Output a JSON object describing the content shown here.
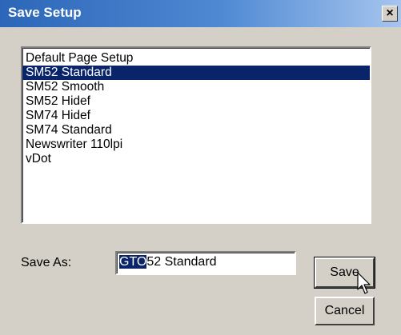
{
  "window": {
    "title": "Save Setup",
    "close_glyph": "×"
  },
  "setup_list": {
    "items": [
      {
        "label": "Default Page Setup",
        "selected": false
      },
      {
        "label": "SM52 Standard",
        "selected": true
      },
      {
        "label": "SM52 Smooth",
        "selected": false
      },
      {
        "label": "SM52 Hidef",
        "selected": false
      },
      {
        "label": "SM74 Hidef",
        "selected": false
      },
      {
        "label": "SM74 Standard",
        "selected": false
      },
      {
        "label": "Newswriter 110lpi",
        "selected": false
      },
      {
        "label": "vDot",
        "selected": false
      }
    ]
  },
  "save_as": {
    "label": "Save As:",
    "value_selected_part": "GTO",
    "value_rest": "52 Standard"
  },
  "buttons": {
    "save_label": "Save",
    "cancel_label": "Cancel"
  },
  "colors": {
    "selection": "#0a246a",
    "dialog_face": "#d4d0c8",
    "titlebar": "#2c66b8"
  },
  "icons": {
    "cursor": "mouse-pointer-icon",
    "close": "close-icon"
  }
}
